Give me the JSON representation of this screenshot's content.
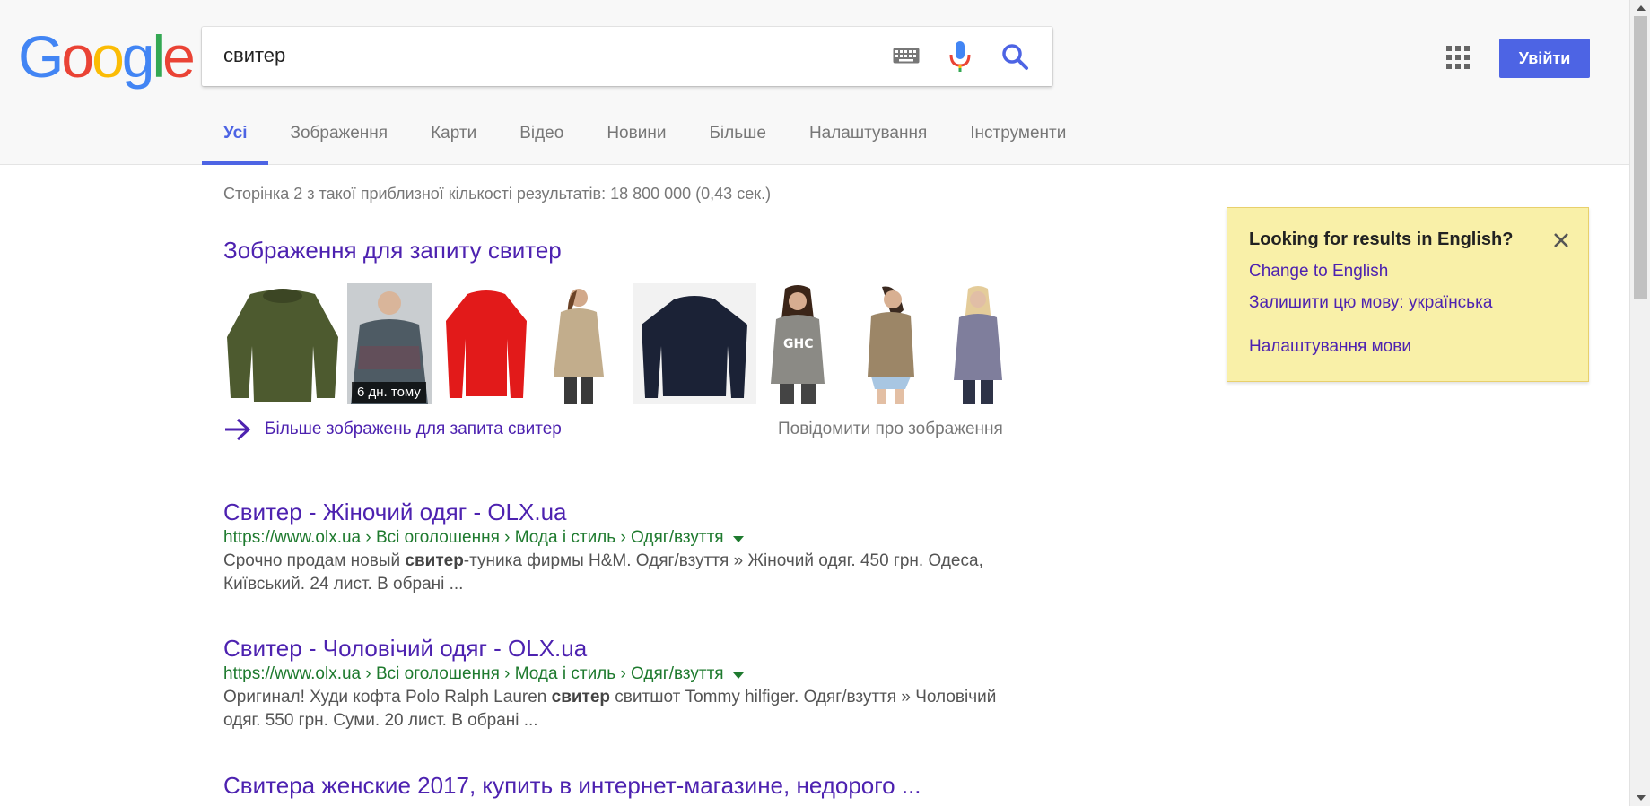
{
  "logo": {
    "letters": [
      "G",
      "o",
      "o",
      "g",
      "l",
      "e"
    ],
    "colors": [
      "#4285f4",
      "#ea4335",
      "#fbbc05",
      "#4285f4",
      "#34a853",
      "#ea4335"
    ]
  },
  "search": {
    "query": "свитер"
  },
  "header": {
    "signin_label": "Увійти"
  },
  "tabs": [
    {
      "label": "Усі"
    },
    {
      "label": "Зображення"
    },
    {
      "label": "Карти"
    },
    {
      "label": "Відео"
    },
    {
      "label": "Новини"
    },
    {
      "label": "Більше"
    },
    {
      "label": "Налаштування"
    },
    {
      "label": "Інструменти"
    }
  ],
  "stats": "Сторінка 2 з такої приблизної кількості результатів: 18 800 000 (0,43 сек.)",
  "images": {
    "heading": "Зображення для запиту свитер",
    "age_badge": "6 дн. тому",
    "more_label": "Більше зображень для запита свитер",
    "report_label": "Повідомити про зображення"
  },
  "results": [
    {
      "title": "Свитер - Жіночий одяг - OLX.ua",
      "url": "https://www.olx.ua › Всі оголошення › Мода і стиль › Одяг/взуття",
      "snippet_pre": "Срочно продам новый ",
      "snippet_bold": "свитер",
      "snippet_post": "-туника фирмы H&M. Одяг/взуття » Жіночий одяг. 450 грн. Одеса, Київський. 24 лист. В обрані ..."
    },
    {
      "title": "Свитер - Чоловічий одяг - OLX.ua",
      "url": "https://www.olx.ua › Всі оголошення › Мода і стиль › Одяг/взуття",
      "snippet_pre": "Оригинал! Худи кофта Polo Ralph Lauren ",
      "snippet_bold": "свитер",
      "snippet_post": " свитшот Tommy hilfiger. Одяг/взуття » Чоловічий одяг. 550 грн. Суми. 20 лист. В обрані ..."
    },
    {
      "title": "Свитера женские 2017, купить в интернет-магазине, недорого ..."
    }
  ],
  "lang_card": {
    "title": "Looking for results in English?",
    "change": "Change to English",
    "keep": "Залишити цю мову: українська",
    "settings": "Налаштування мови"
  },
  "colors": {
    "accent": "#4d64e4",
    "link": "#4d22b0",
    "url": "#1e7a2e",
    "card_bg": "#f9f0a8"
  }
}
